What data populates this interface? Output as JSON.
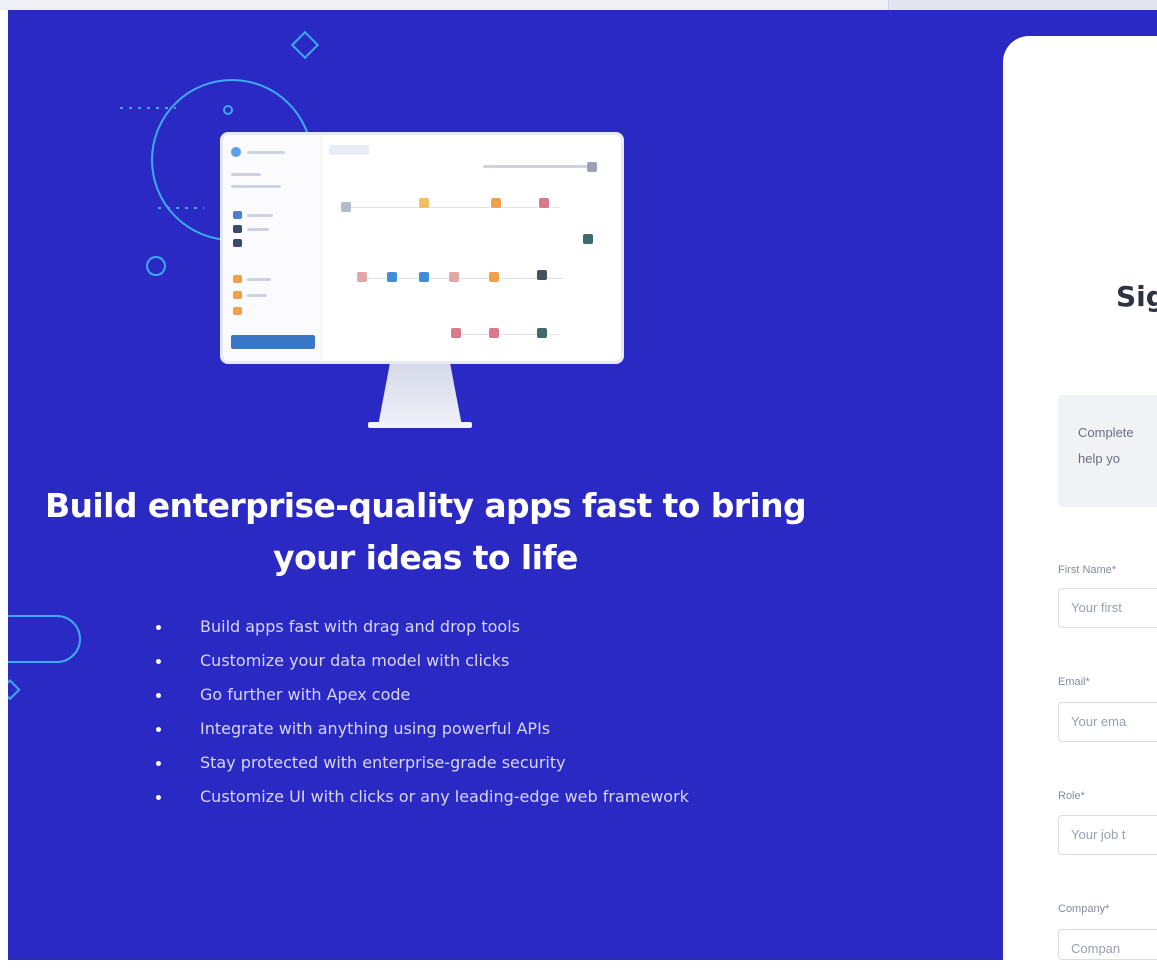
{
  "colors": {
    "hero_background": "#2a29c4",
    "accent_line": "#3fa9f5",
    "form_background": "#ffffff"
  },
  "hero": {
    "headline": "Build enterprise-quality apps fast to bring your ideas to life",
    "features": [
      "Build apps fast with drag and drop tools",
      "Customize your data model with clicks",
      "Go further with Apex code",
      "Integrate with anything using powerful APIs",
      "Stay protected with enterprise-grade security",
      "Customize UI with clicks or any leading-edge web framework"
    ],
    "illustration": "monitor-with-app-builder"
  },
  "form": {
    "title": "Sig",
    "intro_lines": [
      "Complete",
      "help yo"
    ],
    "fields": [
      {
        "label": "First Name*",
        "placeholder": "Your first"
      },
      {
        "label": "Email*",
        "placeholder": "Your ema"
      },
      {
        "label": "Role*",
        "placeholder": "Your job t"
      },
      {
        "label": "Company*",
        "placeholder": "Compan"
      }
    ]
  }
}
